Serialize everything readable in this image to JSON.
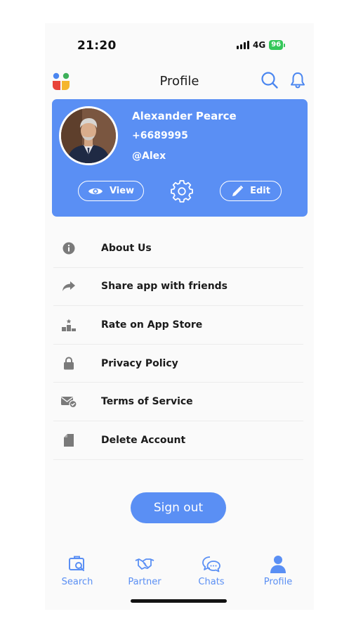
{
  "status_bar": {
    "time": "21:20",
    "network": "4G",
    "battery": "96"
  },
  "header": {
    "title": "Profile",
    "logo_icon": "app-logo-icon",
    "search_icon": "search-icon",
    "bell_icon": "bell-icon"
  },
  "profile": {
    "name": "Alexander Pearce",
    "phone": "+6689995",
    "handle": "@Alex",
    "view_label": "View",
    "edit_label": "Edit"
  },
  "menu": [
    {
      "label": "About Us",
      "icon": "info-icon"
    },
    {
      "label": "Share app with friends",
      "icon": "share-icon"
    },
    {
      "label": "Rate on App Store",
      "icon": "podium-icon"
    },
    {
      "label": "Privacy Policy",
      "icon": "lock-icon"
    },
    {
      "label": "Terms of Service",
      "icon": "mail-check-icon"
    },
    {
      "label": "Delete Account",
      "icon": "document-icon"
    }
  ],
  "signout_label": "Sign out",
  "tabs": [
    {
      "label": "Search",
      "icon": "search-briefcase-icon"
    },
    {
      "label": "Partner",
      "icon": "handshake-icon"
    },
    {
      "label": "Chats",
      "icon": "chat-icon"
    },
    {
      "label": "Profile",
      "icon": "person-icon"
    }
  ],
  "colors": {
    "accent": "#5a8ff4",
    "battery": "#34c759",
    "icon_gray": "#7a7a7a"
  }
}
